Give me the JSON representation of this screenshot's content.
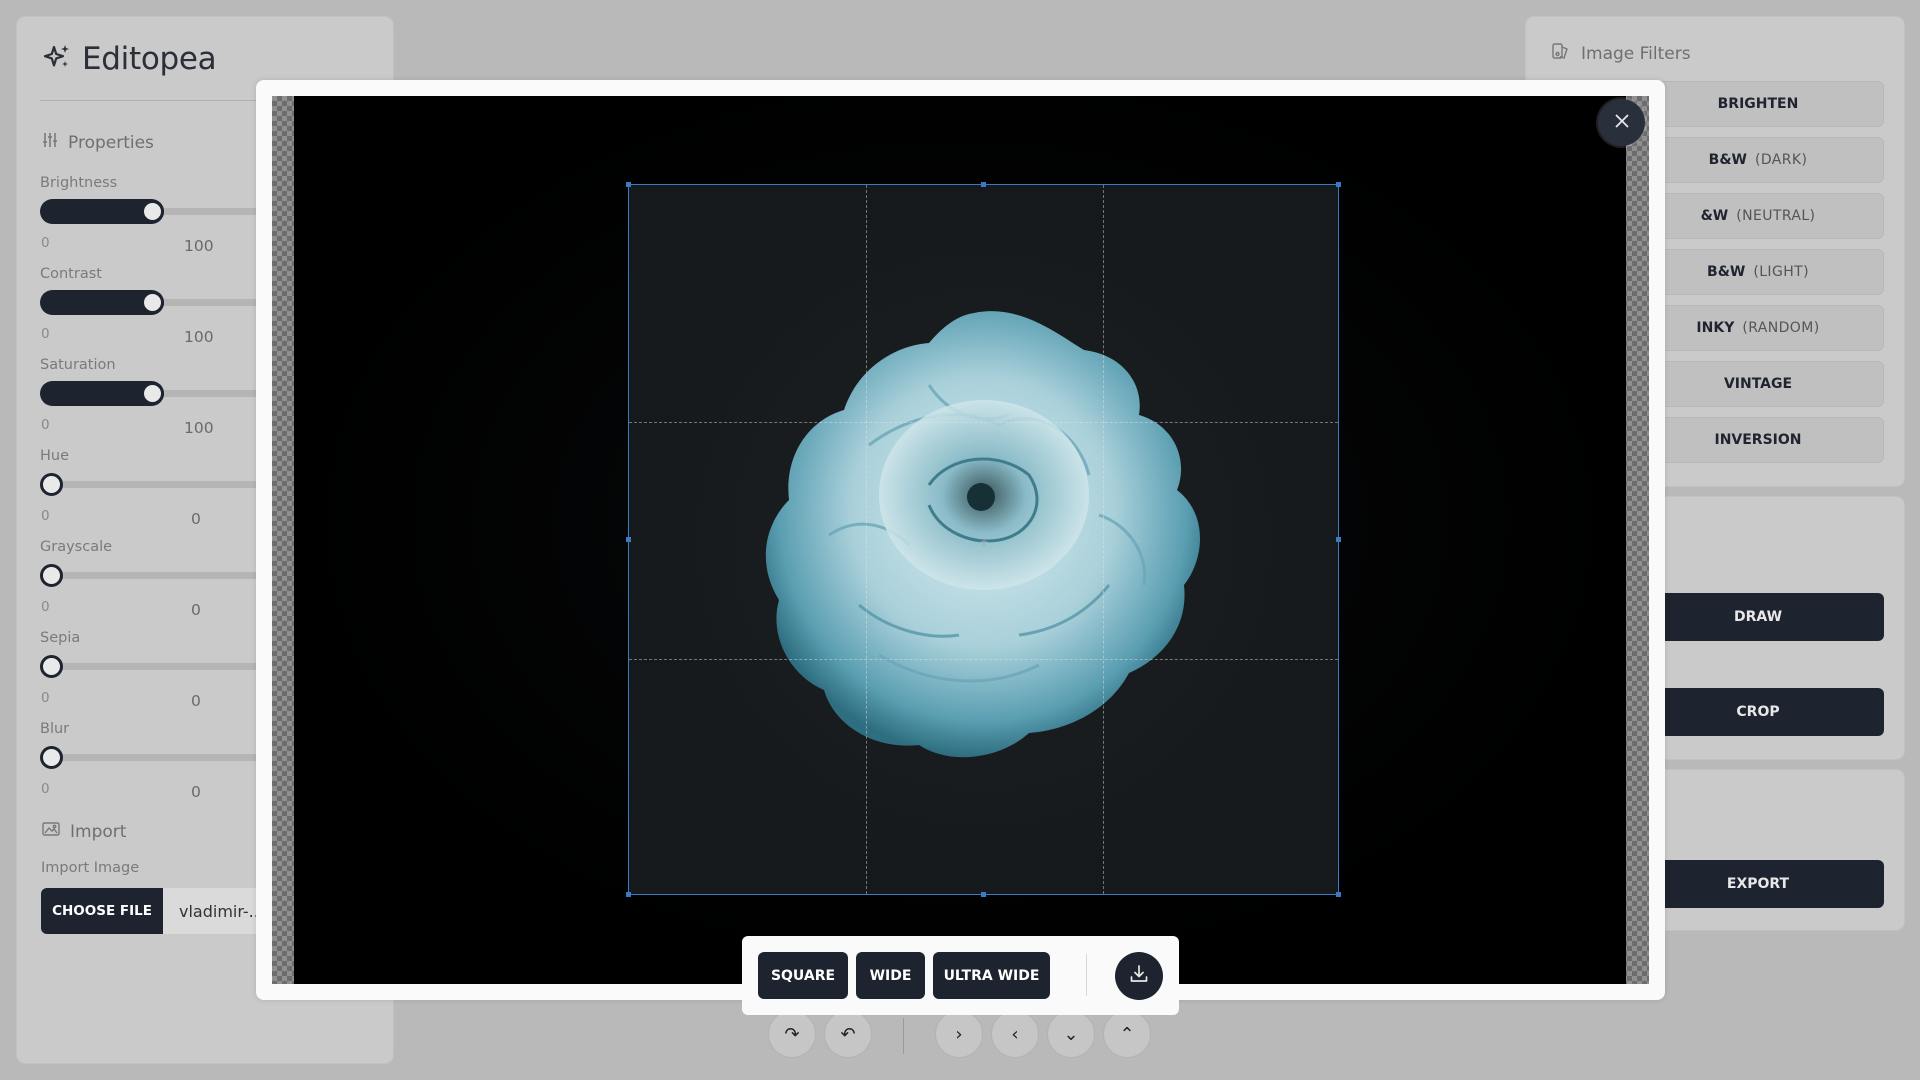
{
  "app": {
    "title": "Editopea"
  },
  "properties": {
    "heading": "Properties",
    "sliders": [
      {
        "label": "Brightness",
        "min": "0",
        "value": "100",
        "fraction": 0.28
      },
      {
        "label": "Contrast",
        "min": "0",
        "value": "100",
        "fraction": 0.28
      },
      {
        "label": "Saturation",
        "min": "0",
        "value": "100",
        "fraction": 0.28
      },
      {
        "label": "Hue",
        "min": "0",
        "value": "0",
        "fraction": 0
      },
      {
        "label": "Grayscale",
        "min": "0",
        "value": "0",
        "fraction": 0
      },
      {
        "label": "Sepia",
        "min": "0",
        "value": "0",
        "fraction": 0
      },
      {
        "label": "Blur",
        "min": "0",
        "value": "0",
        "fraction": 0
      }
    ]
  },
  "import": {
    "heading": "Import",
    "label": "Import Image",
    "button": "CHOOSE FILE",
    "file_name": "vladimir-..."
  },
  "filters": {
    "heading": "Image Filters",
    "items": [
      {
        "label": "BRIGHTEN",
        "sub": ""
      },
      {
        "label": "B&W",
        "sub": "(DARK)"
      },
      {
        "label": "&W",
        "sub": "(NEUTRAL)"
      },
      {
        "label": "B&W",
        "sub": "(LIGHT)"
      },
      {
        "label": "INKY",
        "sub": "(RANDOM)"
      },
      {
        "label": "VINTAGE",
        "sub": ""
      },
      {
        "label": "INVERSION",
        "sub": ""
      }
    ]
  },
  "tools": {
    "draw": "DRAW",
    "crop": "CROP"
  },
  "export": {
    "label": "EXPORT"
  },
  "crop_toolbar": {
    "square": "SQUARE",
    "wide": "WIDE",
    "ultra_wide": "ULTRA WIDE"
  },
  "bottom_controls": {
    "icons": [
      "redo-icon",
      "undo-icon",
      "chevron-right-icon",
      "chevron-left-icon",
      "chevron-down-icon",
      "chevron-up-icon"
    ]
  },
  "colors": {
    "accent_dark": "#1e2330",
    "crop_border": "#3b7ac2",
    "panel_bg": "#cacaca",
    "page_bg": "#b9b9b9"
  }
}
